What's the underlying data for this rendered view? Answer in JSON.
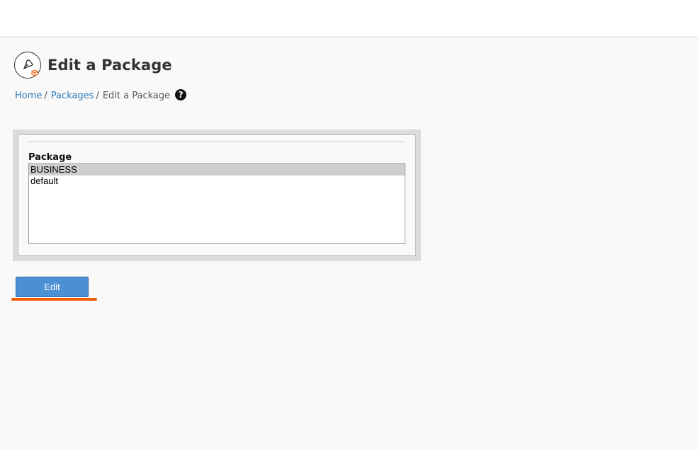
{
  "header": {
    "title": "Edit a Package"
  },
  "breadcrumb": {
    "items": [
      {
        "label": "Home"
      },
      {
        "label": "Packages"
      }
    ],
    "separator": "/",
    "current": "Edit a Package"
  },
  "form": {
    "package_label": "Package",
    "options": [
      "BUSINESS",
      "default"
    ],
    "selected": "BUSINESS"
  },
  "actions": {
    "edit_label": "Edit"
  },
  "colors": {
    "link": "#2f7ab8",
    "button": "#4a90d2",
    "highlight": "#f25c05",
    "icon_accent": "#f25c05"
  },
  "icons": {
    "page": "package-editor-icon",
    "help": "question-circle-icon"
  }
}
